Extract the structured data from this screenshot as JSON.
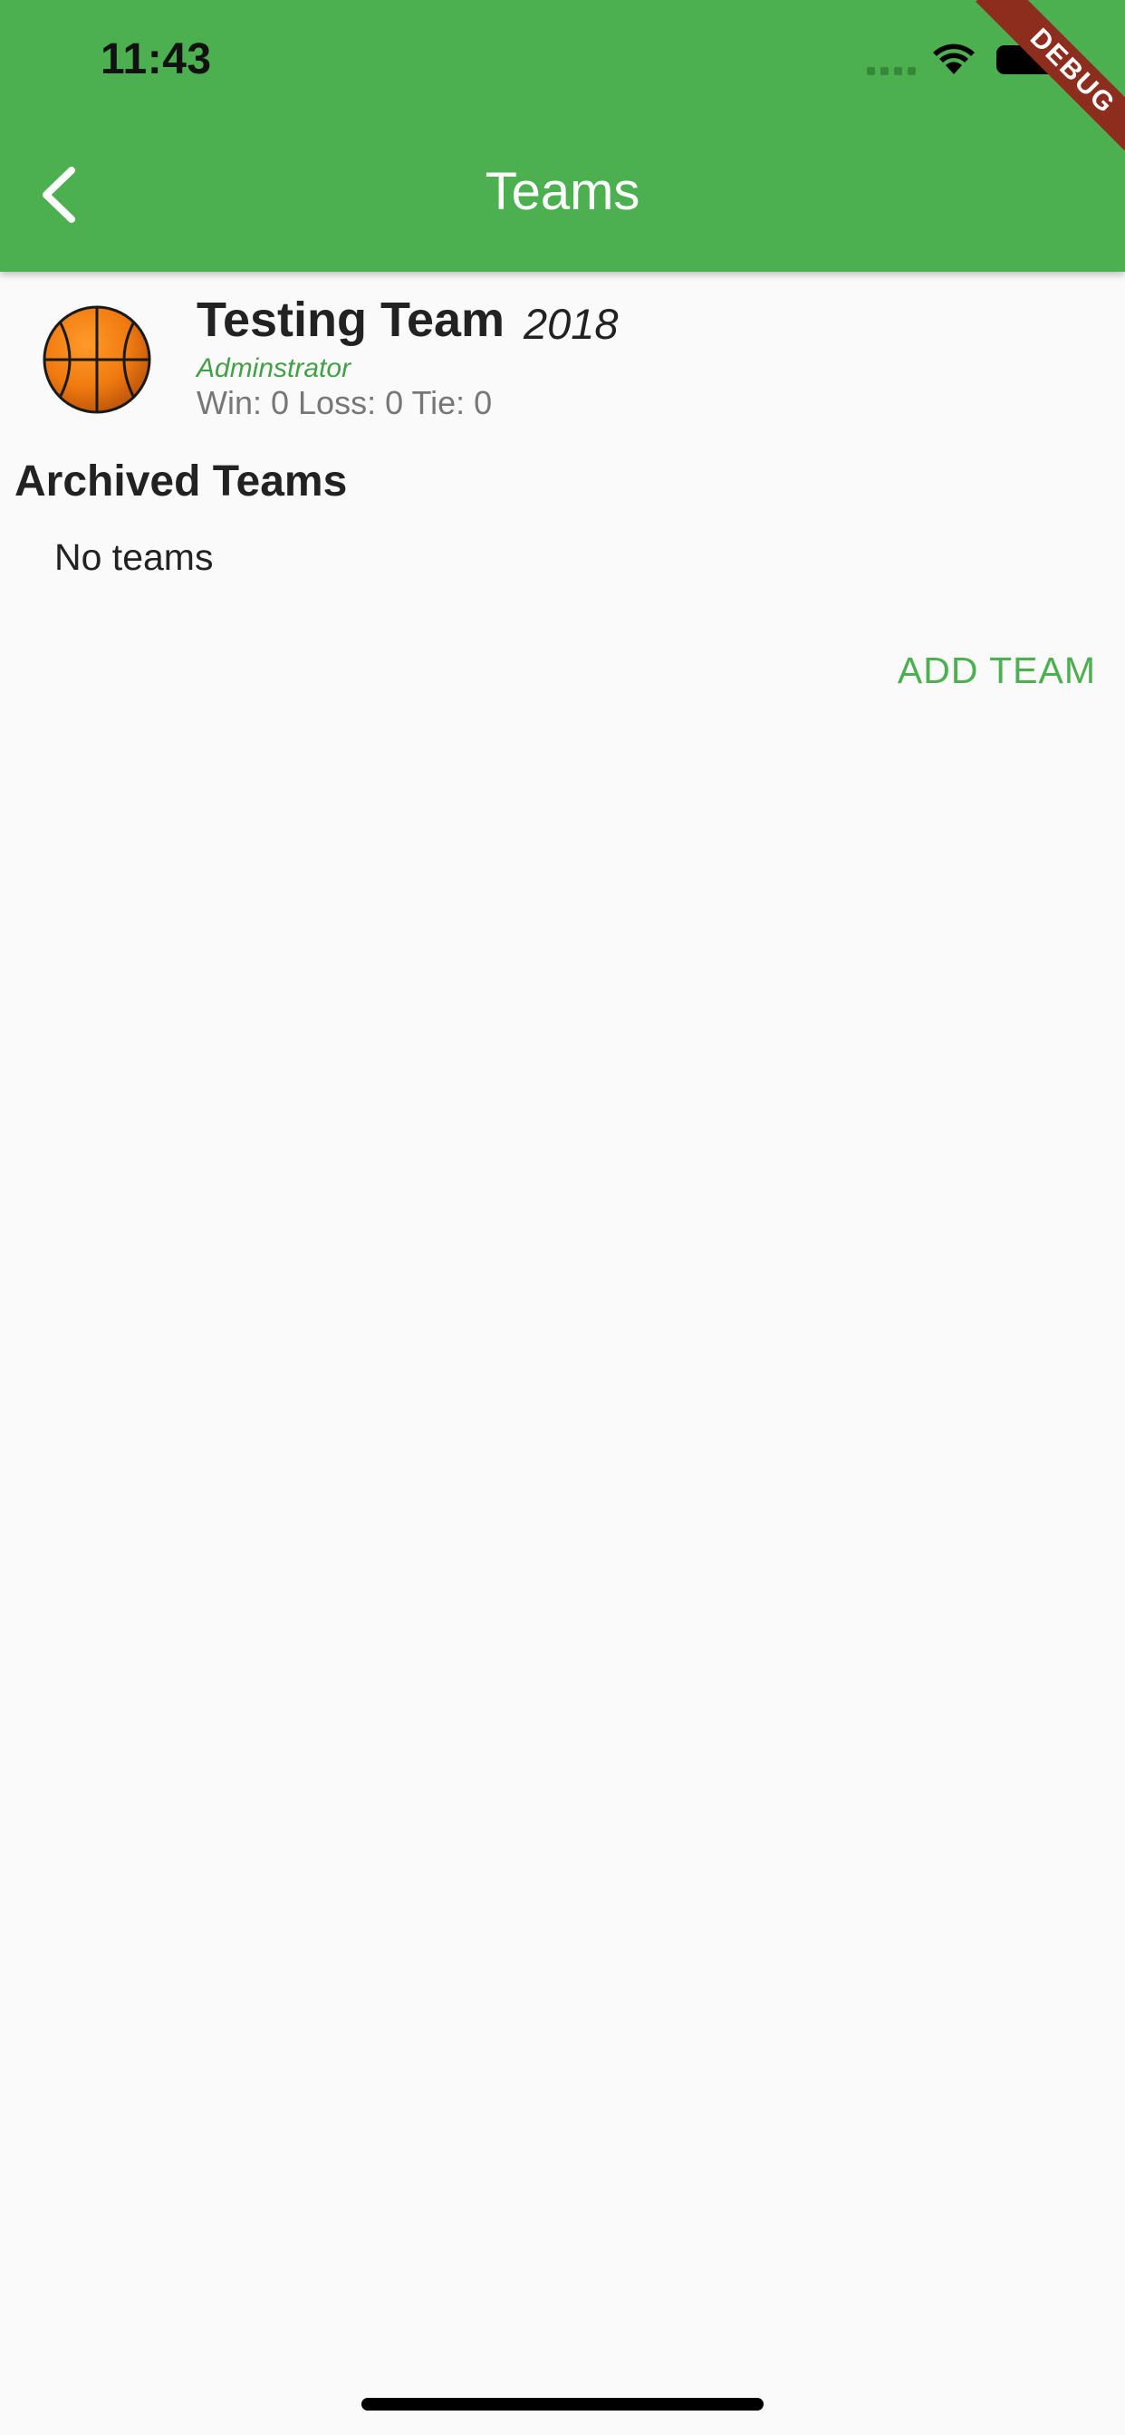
{
  "status_bar": {
    "time": "11:43"
  },
  "app_bar": {
    "title": "Teams",
    "back_icon": "chevron-left-icon",
    "color": "#4caf50"
  },
  "debug_banner": {
    "label": "DEBUG",
    "color": "#8d2d1e"
  },
  "team": {
    "name": "Testing Team",
    "year": "2018",
    "role": "Adminstrator",
    "record": "Win: 0 Loss: 0 Tie: 0",
    "icon": "basketball-icon"
  },
  "archived": {
    "title": "Archived Teams",
    "empty_text": "No teams"
  },
  "actions": {
    "add_team_label": "ADD TEAM"
  }
}
